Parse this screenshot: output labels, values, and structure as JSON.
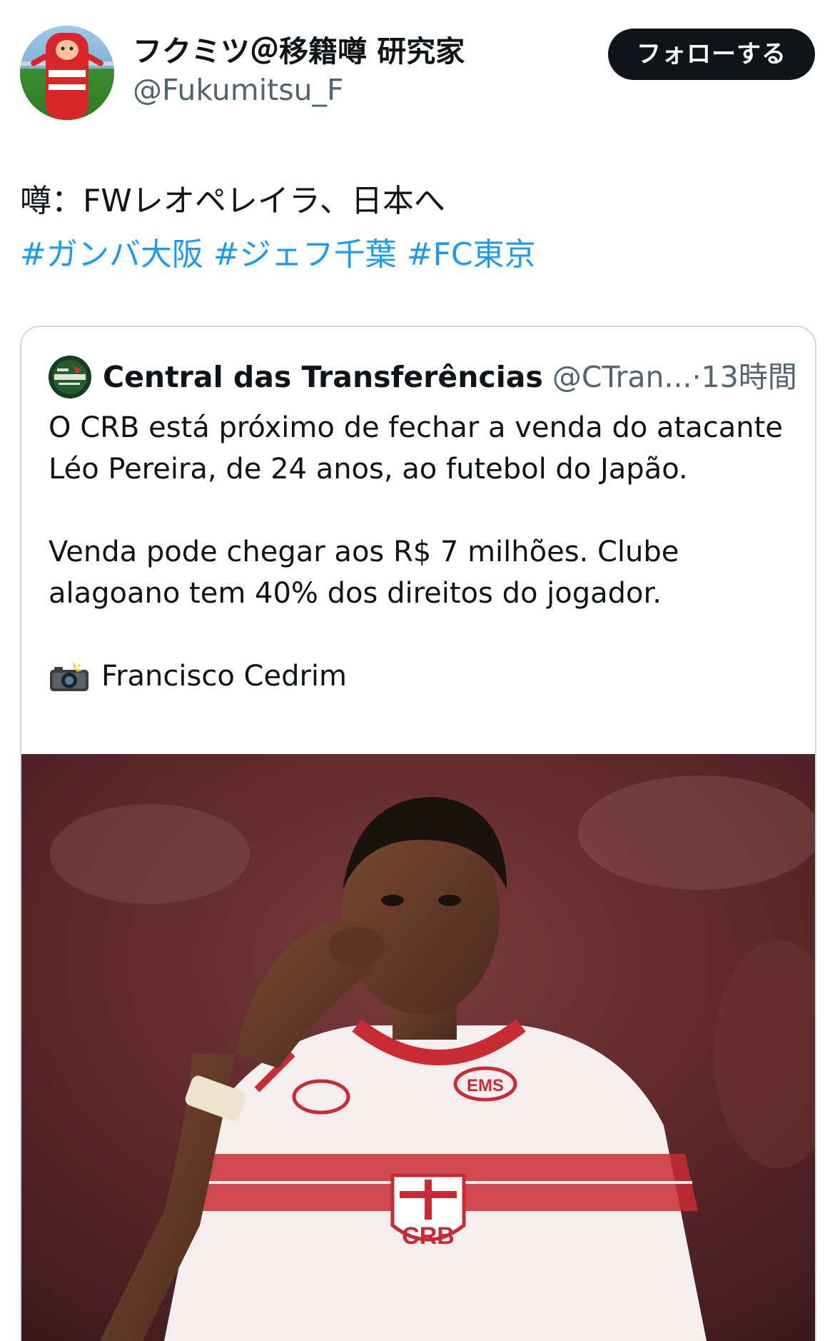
{
  "author": {
    "display_name": "フクミツ＠移籍噂 研究家",
    "handle": "@Fukumitsu_F",
    "avatar_icon": "user-avatar-icon"
  },
  "follow_button": {
    "label": "フォローする"
  },
  "tweet": {
    "text": "噂：FWレオペレイラ、日本へ",
    "hashtags": [
      "#ガンバ大阪",
      "#ジェフ千葉",
      "#FC東京"
    ]
  },
  "quoted_tweet": {
    "author_name": "Central das Transferências",
    "author_handle": "@CTran...",
    "separator": "·",
    "time": "13時間",
    "paragraphs": [
      "O CRB está próximo de fechar a venda do atacante Léo Pereira, de 24 anos, ao futebol do Japão.",
      "Venda pode chegar aos R$ 7 milhões. Clube alagoano tem 40% dos direitos do jogador."
    ],
    "credit": "Francisco Cedrim",
    "credit_icon": "camera-flash-icon"
  },
  "photo": {
    "jersey_text": "CRB",
    "sponsor_text": "EMS"
  },
  "colors": {
    "link_blue": "#1d9bf0",
    "text_primary": "#0f1419",
    "text_secondary": "#536471",
    "border": "#cfd9de",
    "button_bg": "#0f1419"
  }
}
